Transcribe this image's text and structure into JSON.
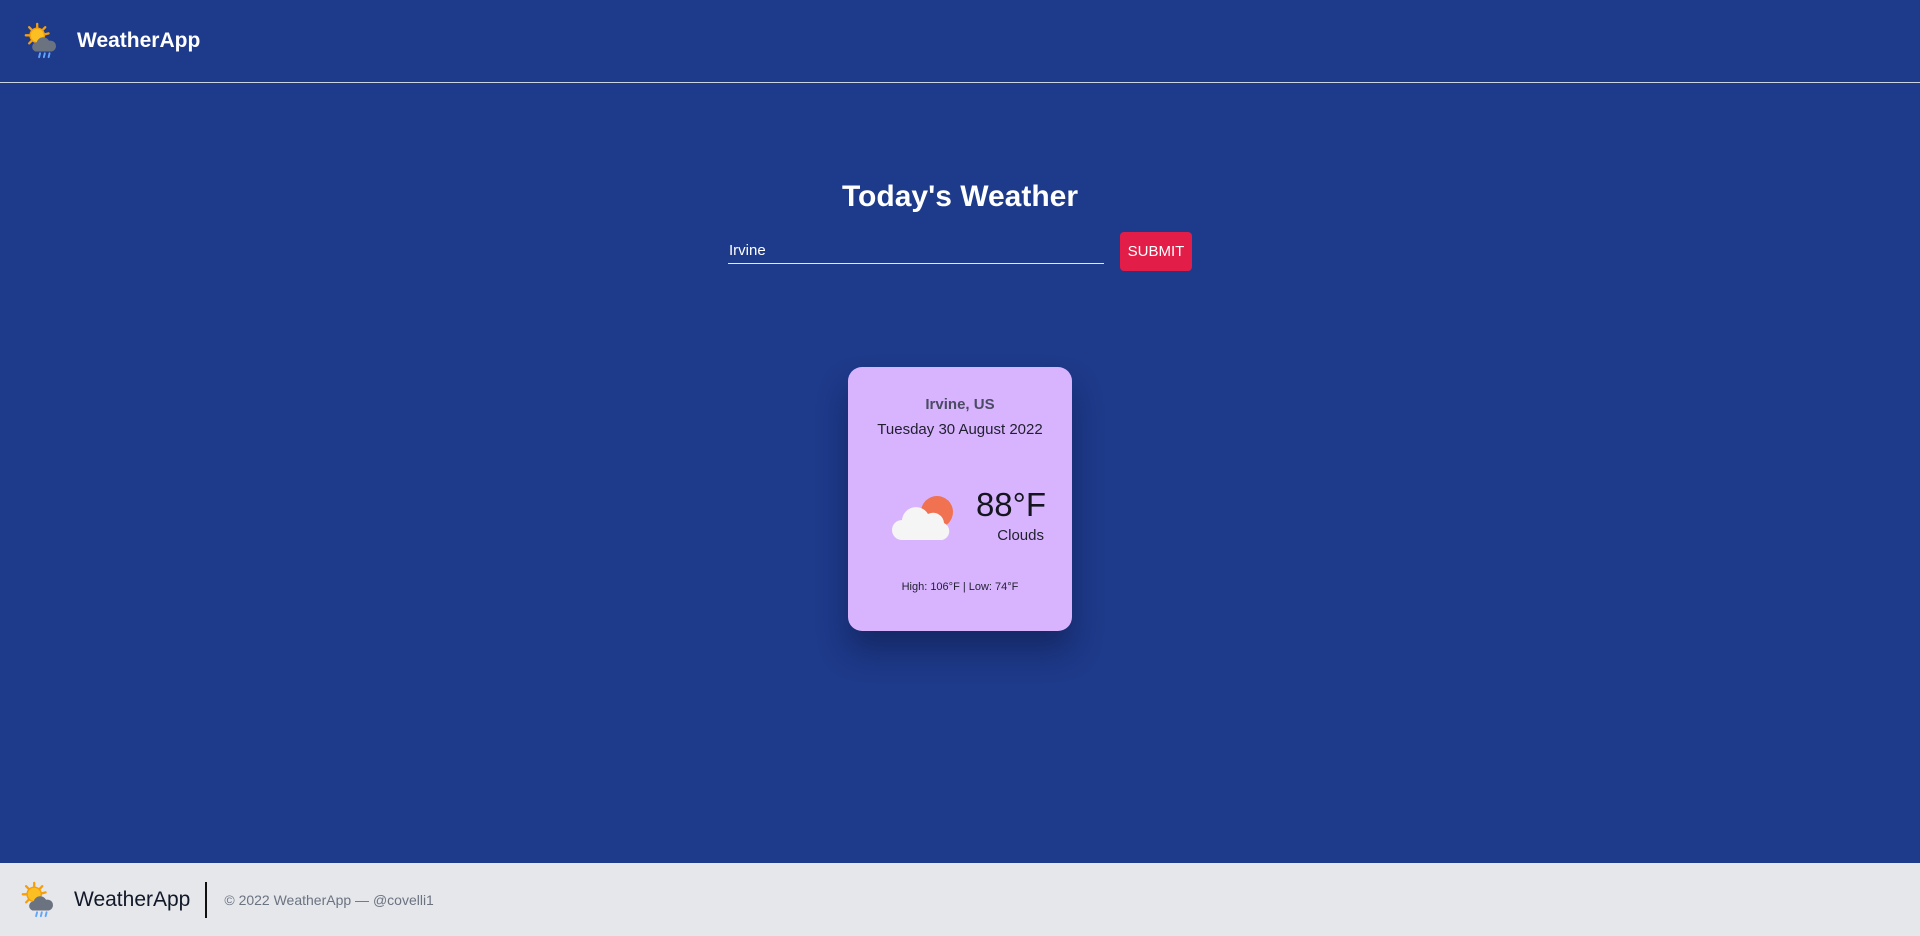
{
  "navbar": {
    "brand_name": "WeatherApp",
    "logo_icon": "sun-cloud-rain-icon"
  },
  "main": {
    "title": "Today's Weather",
    "search": {
      "value": "Irvine",
      "submit_label": "SUBMIT"
    }
  },
  "weather_card": {
    "location": "Irvine, US",
    "date": "Tuesday 30 August 2022",
    "icon": "partly-cloudy-icon",
    "temperature": "88°F",
    "condition": "Clouds",
    "high_low": "High: 106°F | Low: 74°F"
  },
  "footer": {
    "brand_name": "WeatherApp",
    "logo_icon": "sun-cloud-rain-icon",
    "copyright": "© 2022 WeatherApp — @covelli1"
  },
  "colors": {
    "background": "#1e3a8a",
    "submit_button": "#e11d48",
    "card_background": "#d8b4fe",
    "footer_background": "#e5e7eb"
  }
}
